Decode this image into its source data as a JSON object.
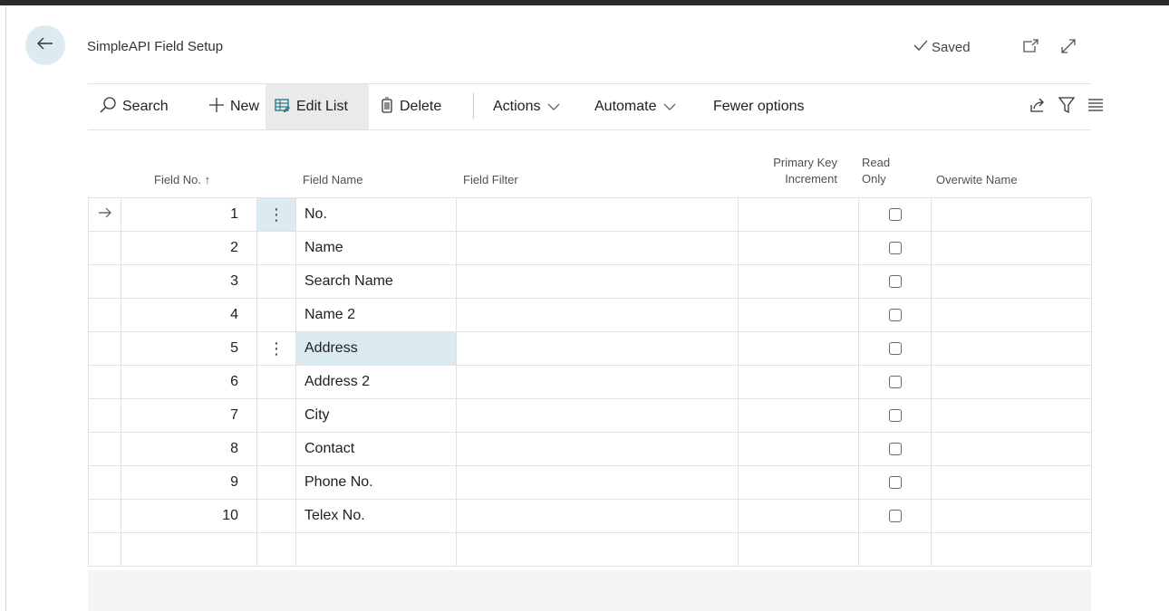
{
  "page": {
    "title": "SimpleAPI Field Setup",
    "saved_label": "Saved"
  },
  "actions": {
    "search": "Search",
    "new": "New",
    "edit_list": "Edit List",
    "delete": "Delete",
    "actions": "Actions",
    "automate": "Automate",
    "fewer_options": "Fewer options"
  },
  "columns": {
    "field_no": "Field No. ↑",
    "field_name": "Field Name",
    "field_filter": "Field Filter",
    "pk_increment_1": "Primary Key",
    "pk_increment_2": "Increment",
    "read_only_1": "Read",
    "read_only_2": "Only",
    "overwrite_name": "Overwite Name"
  },
  "rows": [
    {
      "no": "1",
      "name": "No."
    },
    {
      "no": "2",
      "name": "Name"
    },
    {
      "no": "3",
      "name": "Search Name"
    },
    {
      "no": "4",
      "name": "Name 2"
    },
    {
      "no": "5",
      "name": "Address"
    },
    {
      "no": "6",
      "name": "Address 2"
    },
    {
      "no": "7",
      "name": "City"
    },
    {
      "no": "8",
      "name": "Contact"
    },
    {
      "no": "9",
      "name": "Phone No."
    },
    {
      "no": "10",
      "name": "Telex No."
    }
  ],
  "icons": {
    "back": "back-arrow-icon",
    "saved": "checkmark-icon",
    "open_new_window": "open-in-new-window-icon",
    "expand": "expand-icon",
    "search": "search-icon",
    "new": "plus-icon",
    "edit_list": "edit-list-icon",
    "delete": "trash-icon",
    "share": "share-icon",
    "filter": "filter-icon",
    "list_view": "list-view-icon",
    "row_pointer": "row-arrow-icon",
    "row_menu": "ellipsis-vertical-icon"
  },
  "colors": {
    "accent": "#dcebef",
    "selected_cell": "#dcebef",
    "edit_list_icon": "#2d7d8f"
  }
}
